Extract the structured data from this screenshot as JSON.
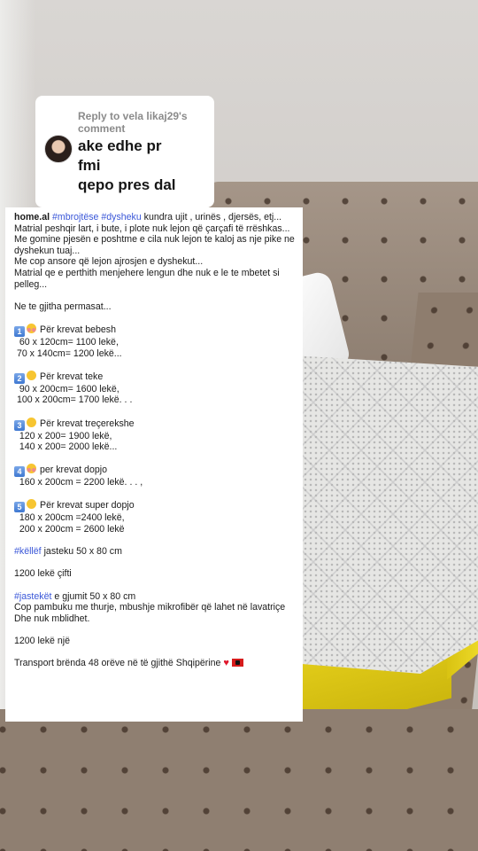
{
  "reply_sticker": {
    "header": "Reply to vela likaj29's comment",
    "lines": [
      "ake edhe pr",
      "fmi",
      "qepo pres dal"
    ]
  },
  "caption": {
    "brand": "home.al",
    "hashtag1": "#mbrojtëse",
    "hashtag2": "#dysheku",
    "intro1_rest": "kundra ujit , urinës , djersës, etj...",
    "intro2": "Matrial peshqir lart, i bute, i plote nuk lejon që çarçafi të rrëshkas...",
    "intro3": "Me gomine pjesën e poshtme e cila nuk lejon te kaloj as nje pike ne dyshekun tuaj...",
    "intro4": "Me  cop ansore  që lejon ajrosjen e dyshekut...",
    "intro5": "Matrial qe e perthith menjehere lengun dhe nuk e le te mbetet si pelleg...",
    "sizes_intro": "Ne te gjitha permasat...",
    "groups": [
      {
        "keycap": "1",
        "emoji": "smiling-face-with-hearts-emoji",
        "title": "Për krevat bebesh",
        "lines": [
          "  60 x 120cm= 1100 lekë,",
          " 70 x 140cm= 1200 lekë..."
        ]
      },
      {
        "keycap": "2",
        "emoji": "smiling-face-emoji",
        "title": "Për krevat teke",
        "lines": [
          "  90 x 200cm= 1600 lekë,",
          " 100 x 200cm= 1700 lekë. . ."
        ]
      },
      {
        "keycap": "3",
        "emoji": "hugging-face-emoji",
        "title": "Për krevat  treçerekshe",
        "lines": [
          "  120 x 200= 1900 lekë,",
          "  140 x 200= 2000 lekë..."
        ]
      },
      {
        "keycap": "4",
        "emoji": "smiling-face-with-hearts-emoji",
        "title": "per krevat dopjo",
        "lines": [
          "  160 x 200cm = 2200 lekë. . . ,"
        ]
      },
      {
        "keycap": "5",
        "emoji": "smiling-face-emoji",
        "title": "Për krevat super dopjo",
        "lines": [
          "  180 x 200cm =2400 lekë,",
          "  200 x 200cm = 2600 lekë"
        ]
      }
    ],
    "pillow_tag": "#këllëf",
    "pillow_rest": "jasteku 50 x 80 cm",
    "pillow_price": "1200 lekë çifti",
    "cushion_tag": "#jastekët",
    "cushion_rest": "e gjumit 50 x 80 cm",
    "cushion_desc": "Cop pambuku me thurje, mbushje mikrofibër që lahet në lavatriçe",
    "cushion_desc2": "Dhe nuk mblidhet.",
    "cushion_price": "1200 lekë një",
    "transport": "Transport brënda 48 orëve në të gjithë Shqipërine",
    "transport_icons": [
      "heart-icon",
      "albania-flag-icon"
    ]
  }
}
